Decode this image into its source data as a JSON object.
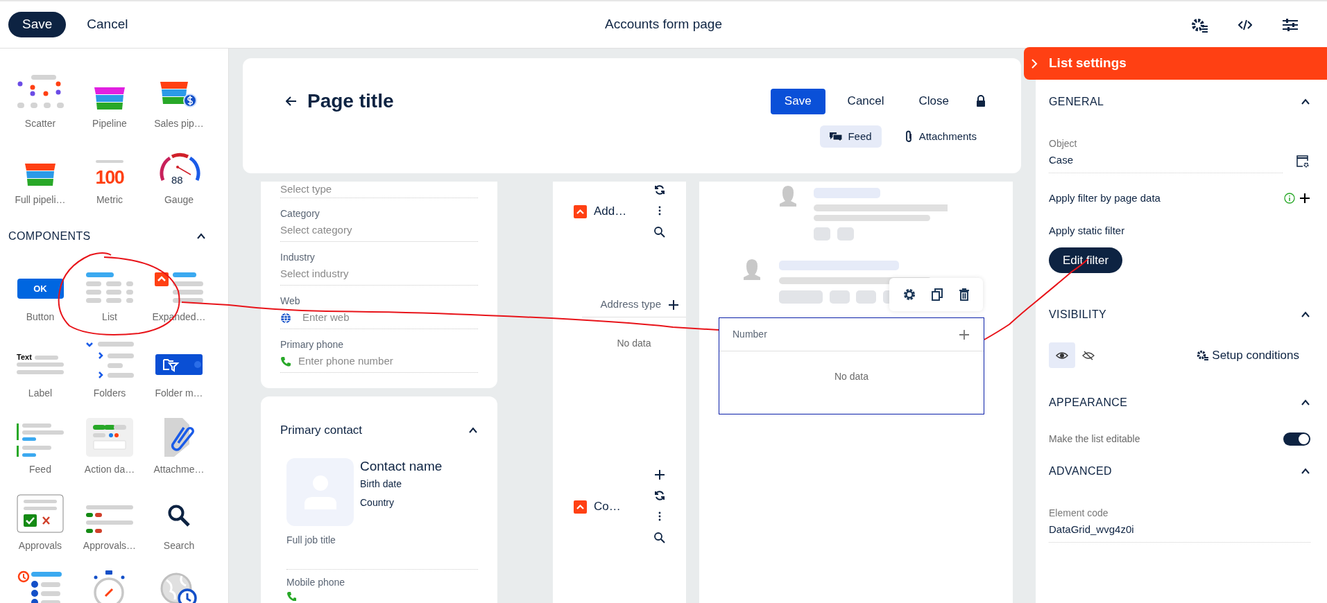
{
  "top_bar": {
    "save": "Save",
    "cancel": "Cancel",
    "title": "Accounts form page"
  },
  "palette": {
    "widgets": [
      {
        "kind": "scatter",
        "label": "Scatter"
      },
      {
        "kind": "pipeline",
        "label": "Pipeline"
      },
      {
        "kind": "sales_pipeline",
        "label": "Sales pip…"
      },
      {
        "kind": "full_pipeline",
        "label": "Full pipeli…"
      },
      {
        "kind": "metric",
        "label": "Metric",
        "icon_text": "100"
      },
      {
        "kind": "gauge",
        "label": "Gauge",
        "icon_text": "88"
      }
    ],
    "components_heading": "COMPONENTS",
    "components_expanded": true,
    "components": [
      {
        "kind": "button",
        "label": "Button",
        "icon_text": "OK"
      },
      {
        "kind": "list",
        "label": "List"
      },
      {
        "kind": "expanded",
        "label": "Expanded…"
      },
      {
        "kind": "label",
        "label": "Label",
        "icon_text": "Text"
      },
      {
        "kind": "folders",
        "label": "Folders"
      },
      {
        "kind": "folder_manager",
        "label": "Folder m…"
      },
      {
        "kind": "feed",
        "label": "Feed"
      },
      {
        "kind": "action_dashboard",
        "label": "Action da…"
      },
      {
        "kind": "attachments",
        "label": "Attachme…"
      },
      {
        "kind": "approvals",
        "label": "Approvals"
      },
      {
        "kind": "approvals_list",
        "label": "Approvals…"
      },
      {
        "kind": "search",
        "label": "Search"
      },
      {
        "kind": "timeline"
      },
      {
        "kind": "stopwatch"
      },
      {
        "kind": "globe_clock"
      }
    ]
  },
  "page_header": {
    "title": "Page title",
    "buttons": [
      "Save",
      "Cancel",
      "Close"
    ],
    "tabs": [
      {
        "label": "Feed",
        "kind": "feed",
        "selected": true
      },
      {
        "label": "Attachments",
        "kind": "attachments",
        "selected": false
      }
    ]
  },
  "fields": [
    {
      "placeholder": "Select type"
    },
    {
      "label": "Category",
      "placeholder": "Select category"
    },
    {
      "label": "Industry",
      "placeholder": "Select industry"
    },
    {
      "label": "Web",
      "placeholder": "Enter web",
      "kind": "web"
    },
    {
      "label": "Primary phone",
      "placeholder": "Enter phone number",
      "kind": "phone"
    }
  ],
  "contact_card": {
    "title": "Primary contact",
    "expanded": true,
    "name": "Contact name",
    "birth_date": "Birth date",
    "country": "Country",
    "job_title": "Full job title",
    "mobile_label": "Mobile phone"
  },
  "lists": [
    {
      "title": "Add…",
      "can_add": false,
      "column": "Address type",
      "empty": "No data"
    },
    {
      "title": "Co…",
      "can_add": true
    }
  ],
  "selected_list": {
    "column": "Number",
    "empty": "No data"
  },
  "settings": {
    "title": "List settings",
    "general": {
      "heading": "GENERAL",
      "expanded": true,
      "object_label": "Object",
      "object_value": "Case",
      "filter_by_page": "Apply filter by page data",
      "static_filter": "Apply static filter",
      "edit_filter": "Edit filter"
    },
    "visibility": {
      "heading": "VISIBILITY",
      "expanded": true,
      "options": [
        {
          "kind": "visible",
          "selected": true
        },
        {
          "kind": "hidden",
          "selected": false
        }
      ],
      "setup": "Setup conditions"
    },
    "appearance": {
      "heading": "APPEARANCE",
      "expanded": true,
      "editable_label": "Make the list editable",
      "editable_on": true
    },
    "advanced": {
      "heading": "ADVANCED",
      "expanded": true,
      "code_label": "Element code",
      "code_value": "DataGrid_wvg4z0i"
    }
  }
}
